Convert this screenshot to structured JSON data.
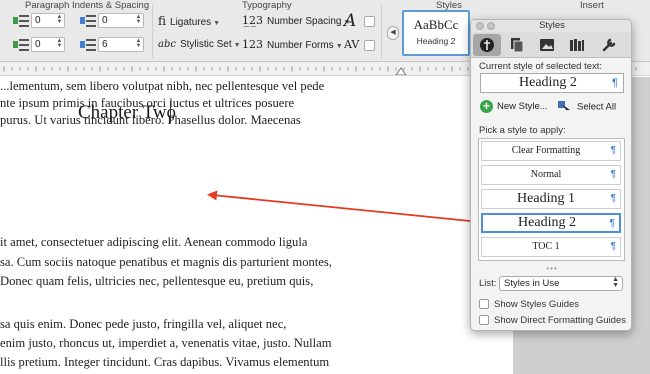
{
  "ribbon": {
    "group_labels": {
      "paragraph": "Paragraph Indents & Spacing",
      "typography": "Typography",
      "styles": "Styles",
      "insert": "Insert"
    },
    "indent_left_value": "0",
    "indent_right_value": "0",
    "spacing_before_value": "0",
    "spacing_after_value": "6",
    "ligatures_label": "Ligatures",
    "stylistic_set_label": "Stylistic Set",
    "number_spacing_label": "Number Spacing",
    "number_forms_label": "Number Forms",
    "gallery_preview": "AaBbCc",
    "gallery_style_name": "Heading 2"
  },
  "document": {
    "lines_top": [
      "...lementum, sem libero volutpat nibh, nec pellentesque vel pede",
      "nte ipsum primis in faucibus orci luctus et ultrices posuere",
      "purus. Ut varius tincidunt libero. Phasellus dolor. Maecenas"
    ],
    "heading": "Chapter Two",
    "lines_mid": [
      "it amet, consectetuer adipiscing elit. Aenean commodo ligula",
      "sa. Cum sociis natoque penatibus et magnis dis parturient montes,",
      "Donec quam felis, ultricies nec, pellentesque eu, pretium quis,"
    ],
    "lines_bottom": [
      "sa quis enim. Donec pede justo, fringilla vel, aliquet nec,",
      "enim justo, rhoncus ut, imperdiet a, venenatis vitae, justo. Nullam",
      "llis pretium. Integer tincidunt. Cras dapibus. Vivamus elementum"
    ]
  },
  "styles_pane": {
    "title": "Styles",
    "current_label": "Current style of selected text:",
    "current_style": "Heading 2",
    "new_style_label": "New Style...",
    "select_all_label": "Select All",
    "pick_label": "Pick a style to apply:",
    "styles": [
      {
        "name": "Clear Formatting",
        "size": 9
      },
      {
        "name": "Normal",
        "size": 9
      },
      {
        "name": "Heading 1",
        "size": 13
      },
      {
        "name": "Heading 2",
        "size": 13
      },
      {
        "name": "TOC 1",
        "size": 9
      }
    ],
    "selected_style_index": 3,
    "pilcrow": "¶",
    "list_label": "List:",
    "list_value": "Styles in Use",
    "show_guides_label": "Show Styles Guides",
    "show_direct_label": "Show Direct Formatting Guides",
    "show_guides_checked": false,
    "show_direct_checked": false
  },
  "colors": {
    "arrow": "#e23b1f",
    "accent": "#4d8fd6",
    "pilcrow": "#2f7bd6",
    "new_style_green": "#3aa64a"
  }
}
